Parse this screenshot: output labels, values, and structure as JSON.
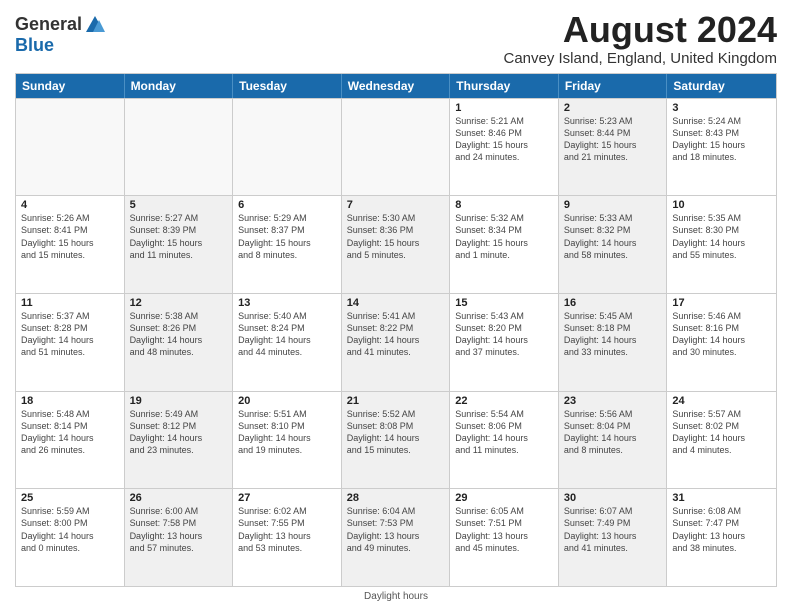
{
  "logo": {
    "line1": "General",
    "line2": "Blue"
  },
  "title": "August 2024",
  "location": "Canvey Island, England, United Kingdom",
  "headers": [
    "Sunday",
    "Monday",
    "Tuesday",
    "Wednesday",
    "Thursday",
    "Friday",
    "Saturday"
  ],
  "footer": "Daylight hours",
  "weeks": [
    [
      {
        "day": "",
        "info": "",
        "empty": true
      },
      {
        "day": "",
        "info": "",
        "empty": true
      },
      {
        "day": "",
        "info": "",
        "empty": true
      },
      {
        "day": "",
        "info": "",
        "empty": true
      },
      {
        "day": "1",
        "info": "Sunrise: 5:21 AM\nSunset: 8:46 PM\nDaylight: 15 hours\nand 24 minutes.",
        "shaded": false
      },
      {
        "day": "2",
        "info": "Sunrise: 5:23 AM\nSunset: 8:44 PM\nDaylight: 15 hours\nand 21 minutes.",
        "shaded": true
      },
      {
        "day": "3",
        "info": "Sunrise: 5:24 AM\nSunset: 8:43 PM\nDaylight: 15 hours\nand 18 minutes.",
        "shaded": false
      }
    ],
    [
      {
        "day": "4",
        "info": "Sunrise: 5:26 AM\nSunset: 8:41 PM\nDaylight: 15 hours\nand 15 minutes.",
        "shaded": false
      },
      {
        "day": "5",
        "info": "Sunrise: 5:27 AM\nSunset: 8:39 PM\nDaylight: 15 hours\nand 11 minutes.",
        "shaded": true
      },
      {
        "day": "6",
        "info": "Sunrise: 5:29 AM\nSunset: 8:37 PM\nDaylight: 15 hours\nand 8 minutes.",
        "shaded": false
      },
      {
        "day": "7",
        "info": "Sunrise: 5:30 AM\nSunset: 8:36 PM\nDaylight: 15 hours\nand 5 minutes.",
        "shaded": true
      },
      {
        "day": "8",
        "info": "Sunrise: 5:32 AM\nSunset: 8:34 PM\nDaylight: 15 hours\nand 1 minute.",
        "shaded": false
      },
      {
        "day": "9",
        "info": "Sunrise: 5:33 AM\nSunset: 8:32 PM\nDaylight: 14 hours\nand 58 minutes.",
        "shaded": true
      },
      {
        "day": "10",
        "info": "Sunrise: 5:35 AM\nSunset: 8:30 PM\nDaylight: 14 hours\nand 55 minutes.",
        "shaded": false
      }
    ],
    [
      {
        "day": "11",
        "info": "Sunrise: 5:37 AM\nSunset: 8:28 PM\nDaylight: 14 hours\nand 51 minutes.",
        "shaded": false
      },
      {
        "day": "12",
        "info": "Sunrise: 5:38 AM\nSunset: 8:26 PM\nDaylight: 14 hours\nand 48 minutes.",
        "shaded": true
      },
      {
        "day": "13",
        "info": "Sunrise: 5:40 AM\nSunset: 8:24 PM\nDaylight: 14 hours\nand 44 minutes.",
        "shaded": false
      },
      {
        "day": "14",
        "info": "Sunrise: 5:41 AM\nSunset: 8:22 PM\nDaylight: 14 hours\nand 41 minutes.",
        "shaded": true
      },
      {
        "day": "15",
        "info": "Sunrise: 5:43 AM\nSunset: 8:20 PM\nDaylight: 14 hours\nand 37 minutes.",
        "shaded": false
      },
      {
        "day": "16",
        "info": "Sunrise: 5:45 AM\nSunset: 8:18 PM\nDaylight: 14 hours\nand 33 minutes.",
        "shaded": true
      },
      {
        "day": "17",
        "info": "Sunrise: 5:46 AM\nSunset: 8:16 PM\nDaylight: 14 hours\nand 30 minutes.",
        "shaded": false
      }
    ],
    [
      {
        "day": "18",
        "info": "Sunrise: 5:48 AM\nSunset: 8:14 PM\nDaylight: 14 hours\nand 26 minutes.",
        "shaded": false
      },
      {
        "day": "19",
        "info": "Sunrise: 5:49 AM\nSunset: 8:12 PM\nDaylight: 14 hours\nand 23 minutes.",
        "shaded": true
      },
      {
        "day": "20",
        "info": "Sunrise: 5:51 AM\nSunset: 8:10 PM\nDaylight: 14 hours\nand 19 minutes.",
        "shaded": false
      },
      {
        "day": "21",
        "info": "Sunrise: 5:52 AM\nSunset: 8:08 PM\nDaylight: 14 hours\nand 15 minutes.",
        "shaded": true
      },
      {
        "day": "22",
        "info": "Sunrise: 5:54 AM\nSunset: 8:06 PM\nDaylight: 14 hours\nand 11 minutes.",
        "shaded": false
      },
      {
        "day": "23",
        "info": "Sunrise: 5:56 AM\nSunset: 8:04 PM\nDaylight: 14 hours\nand 8 minutes.",
        "shaded": true
      },
      {
        "day": "24",
        "info": "Sunrise: 5:57 AM\nSunset: 8:02 PM\nDaylight: 14 hours\nand 4 minutes.",
        "shaded": false
      }
    ],
    [
      {
        "day": "25",
        "info": "Sunrise: 5:59 AM\nSunset: 8:00 PM\nDaylight: 14 hours\nand 0 minutes.",
        "shaded": false
      },
      {
        "day": "26",
        "info": "Sunrise: 6:00 AM\nSunset: 7:58 PM\nDaylight: 13 hours\nand 57 minutes.",
        "shaded": true
      },
      {
        "day": "27",
        "info": "Sunrise: 6:02 AM\nSunset: 7:55 PM\nDaylight: 13 hours\nand 53 minutes.",
        "shaded": false
      },
      {
        "day": "28",
        "info": "Sunrise: 6:04 AM\nSunset: 7:53 PM\nDaylight: 13 hours\nand 49 minutes.",
        "shaded": true
      },
      {
        "day": "29",
        "info": "Sunrise: 6:05 AM\nSunset: 7:51 PM\nDaylight: 13 hours\nand 45 minutes.",
        "shaded": false
      },
      {
        "day": "30",
        "info": "Sunrise: 6:07 AM\nSunset: 7:49 PM\nDaylight: 13 hours\nand 41 minutes.",
        "shaded": true
      },
      {
        "day": "31",
        "info": "Sunrise: 6:08 AM\nSunset: 7:47 PM\nDaylight: 13 hours\nand 38 minutes.",
        "shaded": false
      }
    ]
  ]
}
